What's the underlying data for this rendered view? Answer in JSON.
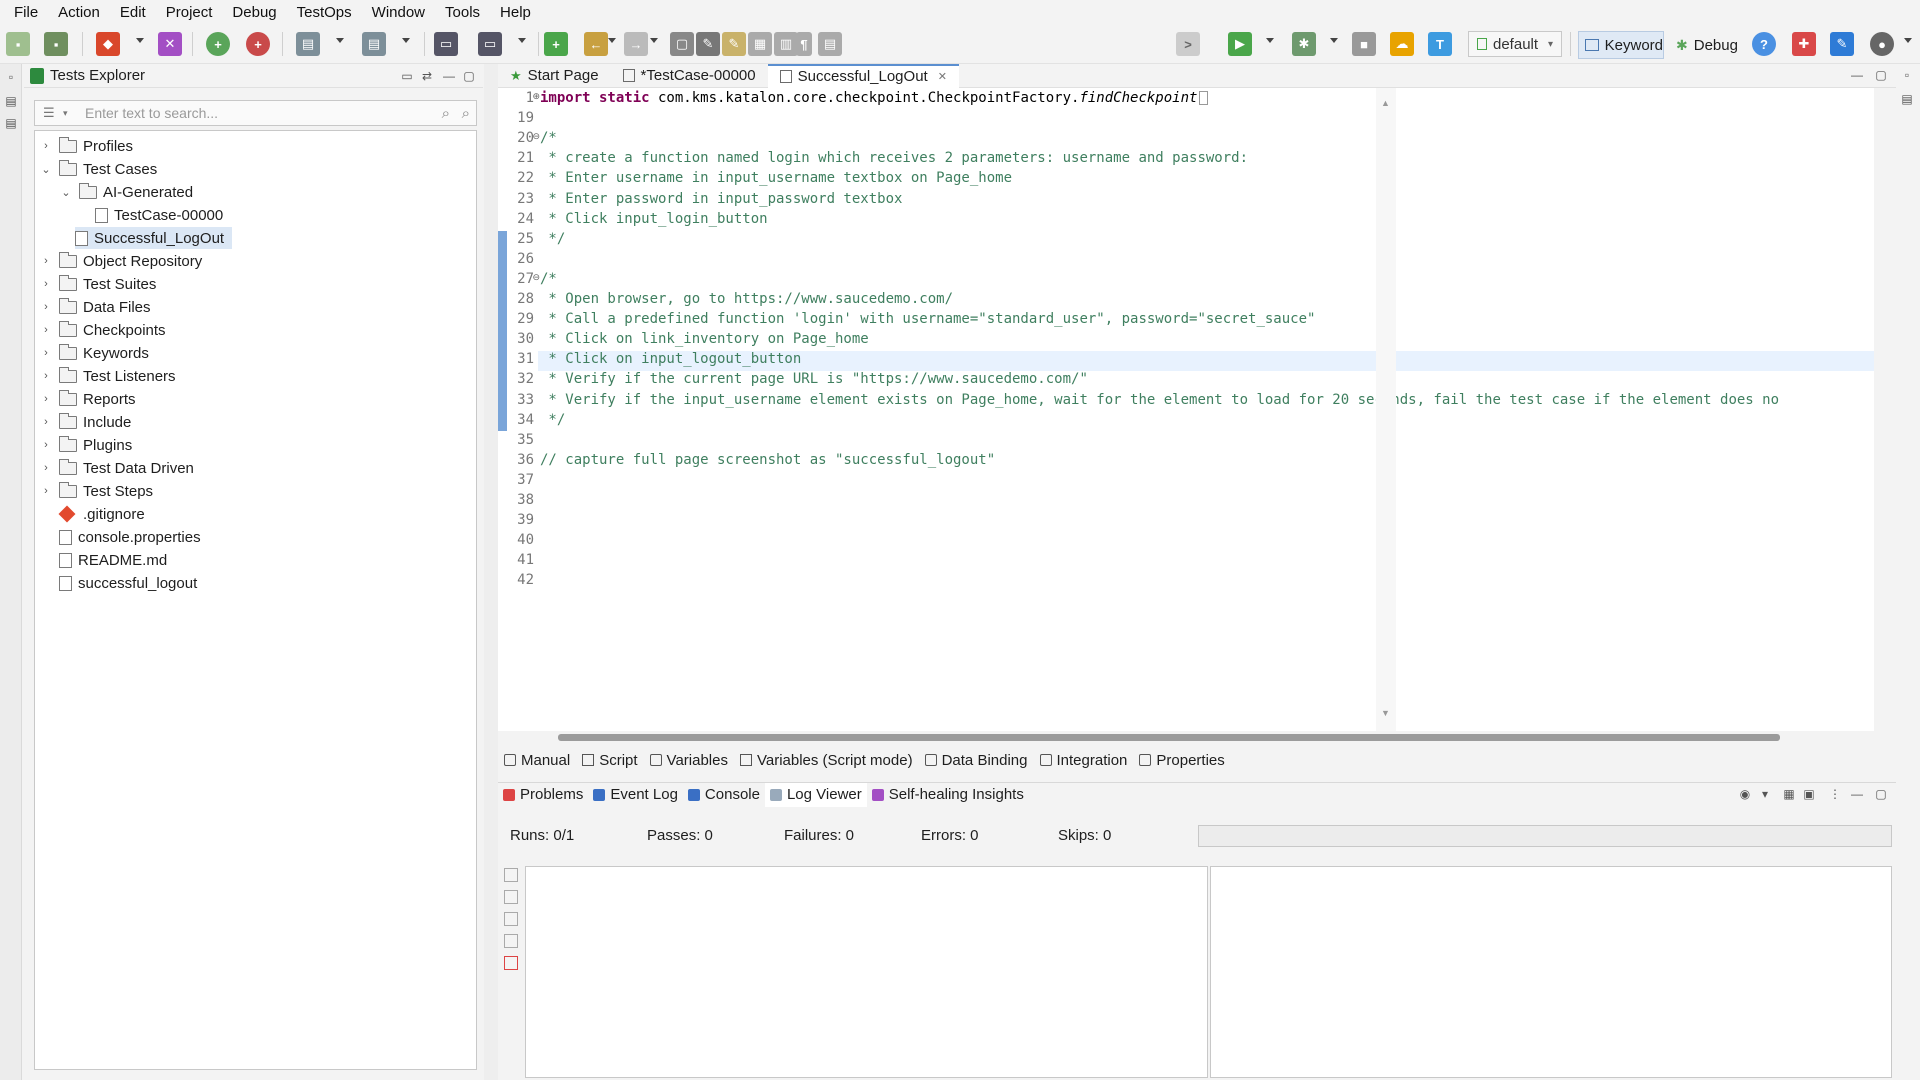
{
  "menu": [
    "File",
    "Action",
    "Edit",
    "Project",
    "Debug",
    "TestOps",
    "Window",
    "Tools",
    "Help"
  ],
  "toolbar": {
    "profile": "default",
    "keyword_label": "Keyword",
    "debug_label": "Debug"
  },
  "explorer": {
    "title": "Tests Explorer",
    "search_placeholder": "Enter text to search...",
    "tree": [
      {
        "label": "Profiles",
        "kind": "folder",
        "depth": 0,
        "expanded": false
      },
      {
        "label": "Test Cases",
        "kind": "folder",
        "depth": 0,
        "expanded": true
      },
      {
        "label": "AI-Generated",
        "kind": "folder",
        "depth": 1,
        "expanded": true
      },
      {
        "label": "TestCase-00000",
        "kind": "testcase",
        "depth": 2
      },
      {
        "label": "Successful_LogOut",
        "kind": "testcase",
        "depth": 1,
        "selected": true
      },
      {
        "label": "Object Repository",
        "kind": "folder",
        "depth": 0,
        "expanded": false
      },
      {
        "label": "Test Suites",
        "kind": "folder",
        "depth": 0,
        "expanded": false
      },
      {
        "label": "Data Files",
        "kind": "folder",
        "depth": 0,
        "expanded": false
      },
      {
        "label": "Checkpoints",
        "kind": "folder",
        "depth": 0,
        "expanded": false
      },
      {
        "label": "Keywords",
        "kind": "folder",
        "depth": 0,
        "expanded": false
      },
      {
        "label": "Test Listeners",
        "kind": "folder",
        "depth": 0,
        "expanded": false
      },
      {
        "label": "Reports",
        "kind": "folder",
        "depth": 0,
        "expanded": false
      },
      {
        "label": "Include",
        "kind": "folder",
        "depth": 0,
        "expanded": false
      },
      {
        "label": "Plugins",
        "kind": "folder",
        "depth": 0,
        "expanded": false
      },
      {
        "label": "Test Data Driven",
        "kind": "folder",
        "depth": 0,
        "expanded": false
      },
      {
        "label": "Test Steps",
        "kind": "folder",
        "depth": 0,
        "expanded": false
      },
      {
        "label": ".gitignore",
        "kind": "git",
        "depth": 0
      },
      {
        "label": "console.properties",
        "kind": "file",
        "depth": 0
      },
      {
        "label": "README.md",
        "kind": "file",
        "depth": 0
      },
      {
        "label": "successful_logout",
        "kind": "file",
        "depth": 0
      }
    ]
  },
  "editor": {
    "tabs": [
      {
        "label": "Start Page",
        "active": false
      },
      {
        "label": "*TestCase-00000",
        "active": false
      },
      {
        "label": "Successful_LogOut",
        "active": true,
        "closable": true
      }
    ],
    "lines": [
      {
        "num": "1",
        "marker": "⊕",
        "kind": "import",
        "parts": [
          "import static",
          " com.kms.katalon.core.checkpoint.CheckpointFactory.",
          "findCheckpoint"
        ]
      },
      {
        "num": "19",
        "marker": "",
        "kind": "blank",
        "text": ""
      },
      {
        "num": "20",
        "marker": "⊖",
        "kind": "comment",
        "text": "/*"
      },
      {
        "num": "21",
        "marker": "",
        "kind": "comment",
        "text": " * create a function named login which receives 2 parameters: username and password:"
      },
      {
        "num": "22",
        "marker": "",
        "kind": "comment",
        "text": " * Enter username in input_username textbox on Page_home"
      },
      {
        "num": "23",
        "marker": "",
        "kind": "comment",
        "text": " * Enter password in input_password textbox"
      },
      {
        "num": "24",
        "marker": "",
        "kind": "comment",
        "text": " * Click input_login_button"
      },
      {
        "num": "25",
        "marker": "",
        "kind": "comment",
        "text": " */"
      },
      {
        "num": "26",
        "marker": "",
        "kind": "blank",
        "text": ""
      },
      {
        "num": "27",
        "marker": "⊖",
        "kind": "comment",
        "text": "/*"
      },
      {
        "num": "28",
        "marker": "",
        "kind": "comment",
        "text": " * Open browser, go to https://www.saucedemo.com/"
      },
      {
        "num": "29",
        "marker": "",
        "kind": "comment",
        "text": " * Call a predefined function 'login' with username=\"standard_user\", password=\"secret_sauce\""
      },
      {
        "num": "30",
        "marker": "",
        "kind": "comment",
        "text": " * Click on link_inventory on Page_home"
      },
      {
        "num": "31",
        "marker": "",
        "kind": "comment",
        "text": " * Click on input_logout_button"
      },
      {
        "num": "32",
        "marker": "",
        "kind": "comment",
        "text": " * Verify if the current page URL is \"https://www.saucedemo.com/\""
      },
      {
        "num": "33",
        "marker": "",
        "kind": "comment",
        "text": " * Verify if the input_username element exists on Page_home, wait for the element to load for 20 seconds, fail the test case if the element does no"
      },
      {
        "num": "34",
        "marker": "",
        "kind": "comment",
        "text": " */"
      },
      {
        "num": "35",
        "marker": "",
        "kind": "blank",
        "text": ""
      },
      {
        "num": "36",
        "marker": "",
        "kind": "comment",
        "text": "// capture full page screenshot as \"successful_logout\""
      },
      {
        "num": "37",
        "marker": "",
        "kind": "blank",
        "text": ""
      },
      {
        "num": "38",
        "marker": "",
        "kind": "blank",
        "text": ""
      },
      {
        "num": "39",
        "marker": "",
        "kind": "blank",
        "text": ""
      },
      {
        "num": "40",
        "marker": "",
        "kind": "blank",
        "text": ""
      },
      {
        "num": "41",
        "marker": "",
        "kind": "blank",
        "text": ""
      },
      {
        "num": "42",
        "marker": "",
        "kind": "blank",
        "text": ""
      }
    ]
  },
  "mode_tabs": [
    "Manual",
    "Script",
    "Variables",
    "Variables (Script mode)",
    "Data Binding",
    "Integration",
    "Properties"
  ],
  "panel_tabs": [
    "Problems",
    "Event Log",
    "Console",
    "Log Viewer",
    "Self-healing Insights"
  ],
  "stats": {
    "runs": "Runs: 0/1",
    "passes": "Passes: 0",
    "failures": "Failures: 0",
    "errors": "Errors: 0",
    "skips": "Skips: 0"
  },
  "colors": {
    "accent": "#5b8fd0",
    "keyword": "#7f0055",
    "comment": "#3f7f5f",
    "selection": "#dbe7f5"
  }
}
